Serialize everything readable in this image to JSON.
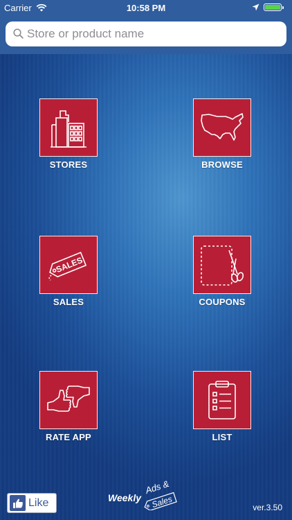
{
  "status_bar": {
    "carrier": "Carrier",
    "time": "10:58 PM",
    "battery_level": 1.0
  },
  "search": {
    "placeholder": "Store or product name",
    "value": ""
  },
  "tiles": [
    {
      "label": "STORES",
      "icon": "buildings-icon"
    },
    {
      "label": "BROWSE",
      "icon": "usa-map-icon"
    },
    {
      "label": "SALES",
      "icon": "sales-tag-icon"
    },
    {
      "label": "COUPONS",
      "icon": "scissors-coupon-icon"
    },
    {
      "label": "RATE APP",
      "icon": "thumbs-up-down-icon"
    },
    {
      "label": "LIST",
      "icon": "clipboard-list-icon"
    }
  ],
  "sales_tag_text": "SALES",
  "like_button": {
    "label": "Like"
  },
  "logo": {
    "line1": "Weekly",
    "line2": "Ads &",
    "line3": "Sales"
  },
  "version": "ver.3.50",
  "colors": {
    "tile_red": "#b81f36",
    "bar_blue": "#2f5d9e",
    "facebook_blue": "#3b5998"
  }
}
